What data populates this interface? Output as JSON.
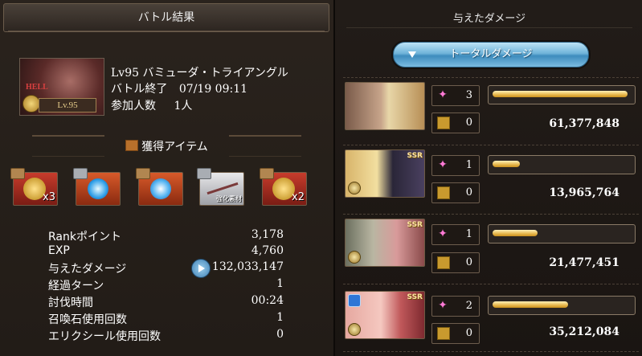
{
  "left": {
    "header": "バトル結果",
    "quest": {
      "thumb_badge": "HELL",
      "thumb_level": "Lv.95",
      "name": "Lv95 バミューダ・トライアングル",
      "end_label": "バトル終了",
      "end_time": "07/19 09:11",
      "participants_label": "参加人数",
      "participants": "1人"
    },
    "items_title": "獲得アイテム",
    "items": [
      {
        "icon": "gold-medal",
        "count": "x3"
      },
      {
        "icon": "blue-orb",
        "count": ""
      },
      {
        "icon": "blue-crystal",
        "count": ""
      },
      {
        "icon": "weapon",
        "count": "",
        "tag": "強化素材"
      },
      {
        "icon": "gold-medal",
        "count": "x2"
      }
    ],
    "stats": [
      {
        "label": "Rankポイント",
        "value": "3,178"
      },
      {
        "label": "EXP",
        "value": "4,760"
      },
      {
        "label": "与えたダメージ",
        "value": "132,033,147"
      },
      {
        "label": "経過ターン",
        "value": "1"
      },
      {
        "label": "討伐時間",
        "value": "00:24"
      },
      {
        "label": "召喚石使用回数",
        "value": "1"
      },
      {
        "label": "エリクシール使用回数",
        "value": "0"
      }
    ]
  },
  "right": {
    "title": "与えたダメージ",
    "total_button": "トータルダメージ",
    "rows": [
      {
        "hits": "3",
        "specials": "0",
        "damage": "61,377,848",
        "fill": 0.99,
        "ssr": ""
      },
      {
        "hits": "1",
        "specials": "0",
        "damage": "13,965,764",
        "fill": 0.2,
        "ssr": "SSR"
      },
      {
        "hits": "1",
        "specials": "0",
        "damage": "21,477,451",
        "fill": 0.33,
        "ssr": "SSR"
      },
      {
        "hits": "2",
        "specials": "0",
        "damage": "35,212,084",
        "fill": 0.55,
        "ssr": "SSR"
      }
    ]
  },
  "colors": {
    "accent_blue": "#6fb3d9",
    "bar_gold": "#e7b74c",
    "bg": "#221c17"
  }
}
